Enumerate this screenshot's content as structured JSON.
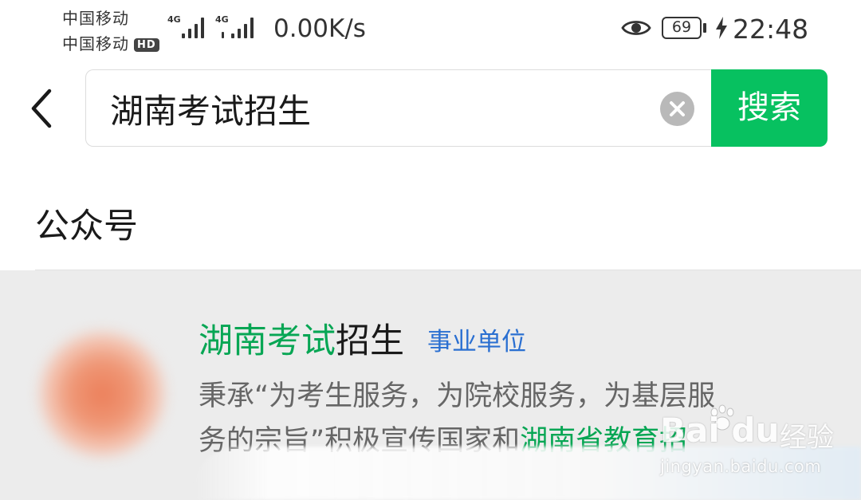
{
  "status_bar": {
    "carrier_1": "中国移动",
    "carrier_2": "中国移动",
    "hd_badge": "HD",
    "signal_1_tag": "4G",
    "signal_2_tag": "4G",
    "net_speed": "0.00K/s",
    "battery": "69",
    "time": "22:48",
    "icons": [
      "eye-icon",
      "battery-icon",
      "charging-bolt-icon"
    ]
  },
  "search": {
    "query": "湖南考试招生",
    "button_label": "搜索",
    "icons": [
      "back-icon",
      "clear-icon"
    ]
  },
  "section": {
    "title": "公众号"
  },
  "result": {
    "name_highlight": "湖南考试",
    "name_rest": "招生",
    "tag": "事业单位",
    "desc_line_1": "秉承“为考生服务，为院校服务，为基层服",
    "desc_line_2_plain": "务的宗旨”积极宣传国家和",
    "desc_line_2_highlight": "湖南省教育招",
    "highlight_color": "#07a654",
    "tag_color": "#2a6fd1"
  },
  "watermark": {
    "logo": "Bai du",
    "suffix": "经验",
    "url": "jingyan.baidu.com"
  },
  "colors": {
    "accent": "#07c160",
    "card_background": "#ececec"
  }
}
